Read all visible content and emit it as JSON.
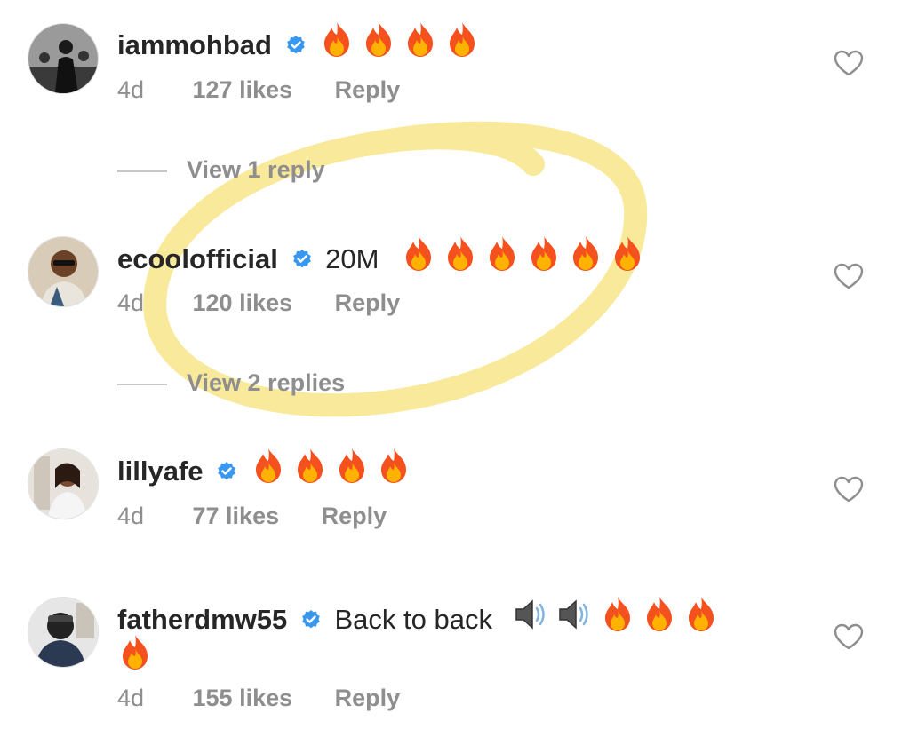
{
  "comments": [
    {
      "username": "iammohbad",
      "text": "",
      "emoji_count": 4,
      "time": "4d",
      "likes": "127 likes",
      "reply": "Reply",
      "view_replies": "View 1 reply"
    },
    {
      "username": "ecoolofficial",
      "text": "20M",
      "emoji_count": 6,
      "time": "4d",
      "likes": "120 likes",
      "reply": "Reply",
      "view_replies": "View 2 replies"
    },
    {
      "username": "lillyafe",
      "text": "",
      "emoji_count": 4,
      "time": "4d",
      "likes": "77 likes",
      "reply": "Reply"
    },
    {
      "username": "fatherdmw55",
      "text": "Back to back",
      "emoji_count": 4,
      "time": "4d",
      "likes": "155 likes",
      "reply": "Reply"
    }
  ],
  "colors": {
    "verified": "#3897f0",
    "secondary_text": "#8e8e8e",
    "highlight": "#f7e27a"
  },
  "icons": {
    "verified": "verified-badge-icon",
    "emoji": "fire-emoji-icon",
    "speaker": "speaker-emoji-icon",
    "like": "heart-outline-icon"
  }
}
